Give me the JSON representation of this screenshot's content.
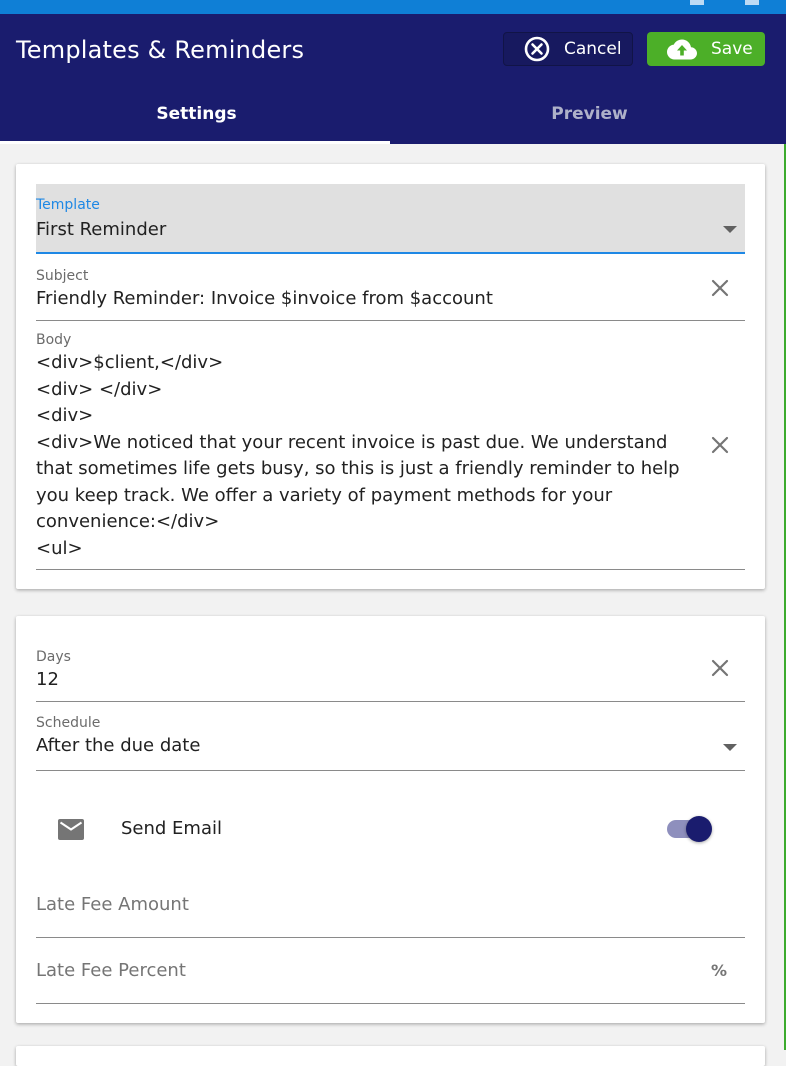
{
  "header": {
    "title": "Templates & Reminders",
    "cancel_label": "Cancel",
    "save_label": "Save",
    "accent_color": "#1a1c6e",
    "save_color": "#4caf28"
  },
  "tabs": [
    {
      "label": "Settings",
      "active": true
    },
    {
      "label": "Preview",
      "active": false
    }
  ],
  "template_card": {
    "template": {
      "label": "Template",
      "value": "First Reminder"
    },
    "subject": {
      "label": "Subject",
      "value": "Friendly Reminder: Invoice $invoice from $account"
    },
    "body": {
      "label": "Body",
      "value": "<div>$client,</div>\n<div> </div>\n<div>\n<div>We noticed that your recent invoice is past due. We understand that sometimes life gets busy, so this is just a friendly reminder to help you keep track. We offer a variety of payment methods for your convenience:</div>\n<ul>"
    }
  },
  "reminder_card": {
    "days": {
      "label": "Days",
      "value": "12"
    },
    "schedule": {
      "label": "Schedule",
      "value": "After the due date"
    },
    "send_email": {
      "label": "Send Email",
      "enabled": true,
      "icon": "email-icon"
    },
    "late_fee_amount": {
      "placeholder": "Late Fee Amount"
    },
    "late_fee_percent": {
      "placeholder": "Late Fee Percent",
      "suffix": "%"
    }
  }
}
